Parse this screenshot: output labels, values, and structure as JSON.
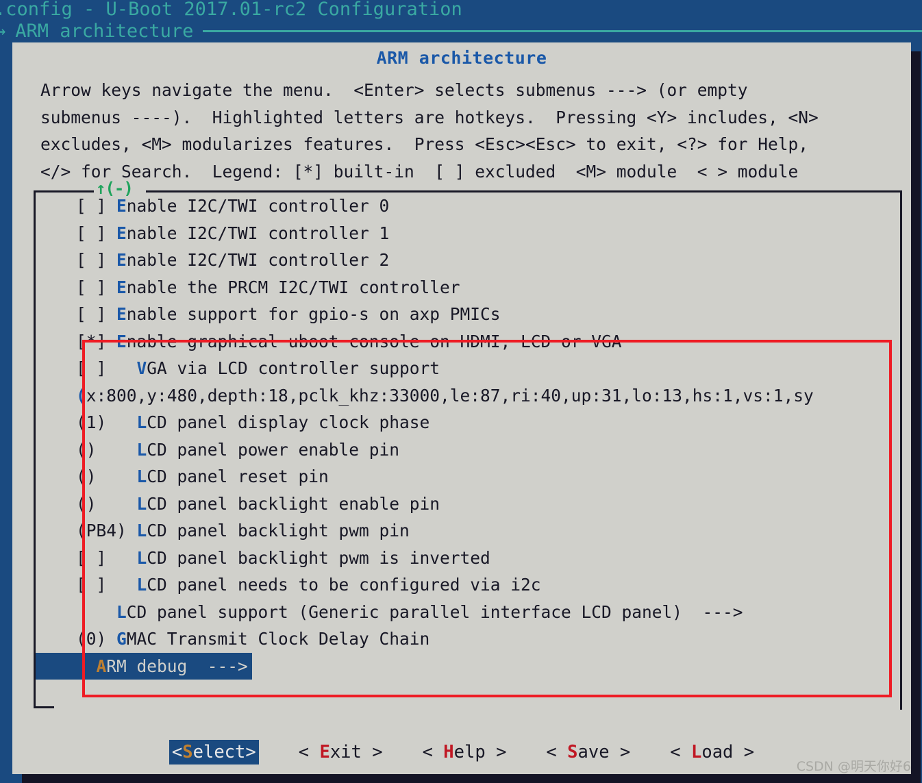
{
  "titlebar": {
    "title": ".config - U-Boot 2017.01-rc2 Configuration",
    "breadcrumb_arrow": "→",
    "breadcrumb": "ARM architecture"
  },
  "dialog": {
    "menu_title": "ARM architecture",
    "help_lines": [
      "Arrow keys navigate the menu.  <Enter> selects submenus ---> (or empty",
      "submenus ----).  Highlighted letters are hotkeys.  Pressing <Y> includes, <N>",
      "excludes, <M> modularizes features.  Press <Esc><Esc> to exit, <?> for Help,",
      "</> for Search.  Legend: [*] built-in  [ ] excluded  <M> module  < > module"
    ],
    "scroll_indicator": "↑(-)"
  },
  "menu_rows": [
    {
      "prefix": "    [ ] ",
      "hotkey": "E",
      "label": "nable I2C/TWI controller 0",
      "selected": false
    },
    {
      "prefix": "    [ ] ",
      "hotkey": "E",
      "label": "nable I2C/TWI controller 1",
      "selected": false
    },
    {
      "prefix": "    [ ] ",
      "hotkey": "E",
      "label": "nable I2C/TWI controller 2",
      "selected": false
    },
    {
      "prefix": "    [ ] ",
      "hotkey": "E",
      "label": "nable the PRCM I2C/TWI controller",
      "selected": false
    },
    {
      "prefix": "    [ ] ",
      "hotkey": "E",
      "label": "nable support for gpio-s on axp PMICs",
      "selected": false
    },
    {
      "prefix": "    [*] ",
      "hotkey": "E",
      "label": "nable graphical uboot console on HDMI, LCD or VGA",
      "selected": false
    },
    {
      "prefix": "    [ ]   ",
      "hotkey": "V",
      "label": "GA via LCD controller support",
      "selected": false
    },
    {
      "prefix": "    ",
      "hotkey": "(",
      "label": "x:800,y:480,depth:18,pclk_khz:33000,le:87,ri:40,up:31,lo:13,hs:1,vs:1,sy",
      "selected": false
    },
    {
      "prefix": "    (1)   ",
      "hotkey": "L",
      "label": "CD panel display clock phase",
      "selected": false
    },
    {
      "prefix": "    ()    ",
      "hotkey": "L",
      "label": "CD panel power enable pin",
      "selected": false
    },
    {
      "prefix": "    ()    ",
      "hotkey": "L",
      "label": "CD panel reset pin",
      "selected": false
    },
    {
      "prefix": "    ()    ",
      "hotkey": "L",
      "label": "CD panel backlight enable pin",
      "selected": false
    },
    {
      "prefix": "    (PB4) ",
      "hotkey": "L",
      "label": "CD panel backlight pwm pin",
      "selected": false
    },
    {
      "prefix": "    [ ]   ",
      "hotkey": "L",
      "label": "CD panel backlight pwm is inverted",
      "selected": false
    },
    {
      "prefix": "    [ ]   ",
      "hotkey": "L",
      "label": "CD panel needs to be configured via i2c",
      "selected": false
    },
    {
      "prefix": "        ",
      "hotkey": "L",
      "label": "CD panel support (Generic parallel interface LCD panel)  --->",
      "selected": false
    },
    {
      "prefix": "    (0) ",
      "hotkey": "G",
      "label": "MAC Transmit Clock Delay Chain",
      "selected": false
    },
    {
      "prefix": "      ",
      "hotkey": "A",
      "label": "RM debug  --->",
      "selected": true
    }
  ],
  "buttons": [
    {
      "pre": "<",
      "hotkey": "S",
      "post": "elect>",
      "active": true
    },
    {
      "pre": "< ",
      "hotkey": "E",
      "post": "xit >",
      "active": false
    },
    {
      "pre": "< ",
      "hotkey": "H",
      "post": "elp >",
      "active": false
    },
    {
      "pre": "< ",
      "hotkey": "S",
      "post": "ave >",
      "active": false
    },
    {
      "pre": "< ",
      "hotkey": "L",
      "post": "oad >",
      "active": false
    }
  ],
  "watermark": "CSDN @明天你好6",
  "colors": {
    "terminal_bg": "#1a4a80",
    "dialog_bg": "#d0d0cb",
    "title_text": "#3aa9a2",
    "hotkey_blue": "#1a58a8",
    "hotkey_red": "#c01824",
    "hotkey_orange": "#c08030",
    "scroll_green": "#1fa35c",
    "annotation_red": "#ee1c24",
    "selection_bg": "#1a4a80"
  }
}
